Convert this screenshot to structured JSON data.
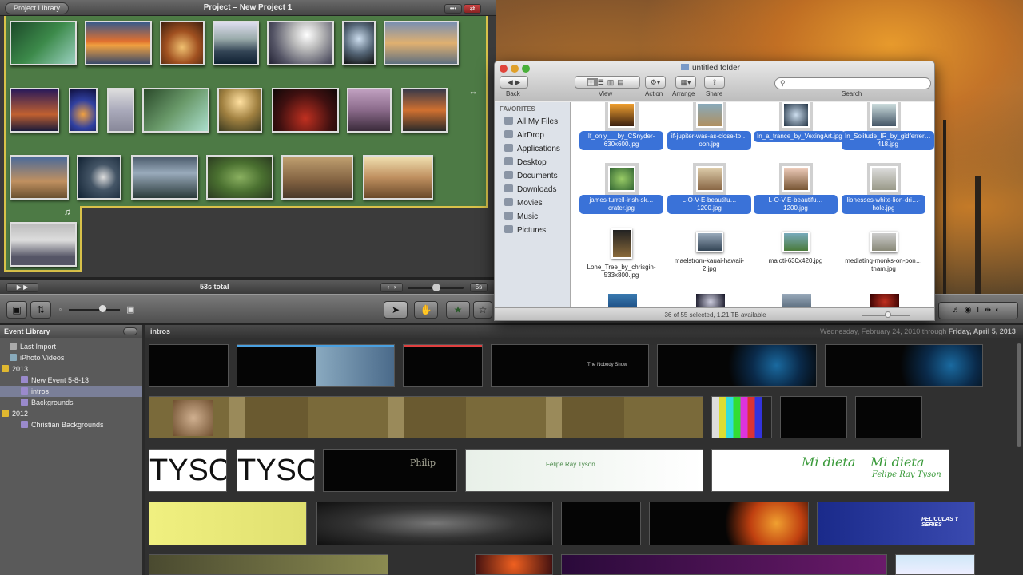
{
  "project": {
    "library_button": "Project Library",
    "title": "Project – New Project 1",
    "total": "53s total"
  },
  "event_library": {
    "header": "Event Library",
    "items": [
      {
        "label": "Last Import",
        "indent": 1,
        "selected": false
      },
      {
        "label": "iPhoto Videos",
        "indent": 1,
        "selected": false
      },
      {
        "label": "2013",
        "indent": 0,
        "selected": false
      },
      {
        "label": "New Event 5-8-13",
        "indent": 2,
        "selected": false
      },
      {
        "label": "intros",
        "indent": 2,
        "selected": true
      },
      {
        "label": "Backgrounds",
        "indent": 2,
        "selected": false
      },
      {
        "label": "2012",
        "indent": 0,
        "selected": false
      },
      {
        "label": "Christian Backgrounds",
        "indent": 2,
        "selected": false
      }
    ]
  },
  "browser": {
    "title": "intros",
    "date_range_prefix": "Wednesday, February 24, 2010",
    "date_range_mid": " through ",
    "date_range_suffix": "Friday, April 5, 2013",
    "clip_texts": {
      "tyson1": "TYSON",
      "tyson2": "TYSON",
      "nobody": "The Nobody Show",
      "mi1": "Mi dieta",
      "mi2": "Mi dieta",
      "felipe": "Felipe Ray Tyson",
      "felipe_green": "Felipe Ray Tyson",
      "philip": "Philip",
      "peliculas": "PELICULAS Y SERIES"
    }
  },
  "finder": {
    "title": "untitled folder",
    "toolbar": {
      "back": "Back",
      "view": "View",
      "action": "Action",
      "arrange": "Arrange",
      "share": "Share",
      "search": "Search"
    },
    "favorites_header": "FAVORITES",
    "favorites": [
      "All My Files",
      "AirDrop",
      "Applications",
      "Desktop",
      "Documents",
      "Downloads",
      "Movies",
      "Music",
      "Pictures"
    ],
    "files": [
      {
        "name": "If_only___by_CSnyder-630x600.jpg",
        "selected": true
      },
      {
        "name": "if-jupiter-was-as-close-to…oon.jpg",
        "selected": true
      },
      {
        "name": "In_a_trance_by_VexingArt.jpg",
        "selected": true
      },
      {
        "name": "In_Solitude_IR_by_gidferrer…418.jpg",
        "selected": true
      },
      {
        "name": "james-turrell-irish-sk…crater.jpg",
        "selected": true
      },
      {
        "name": "L-O-V-E-beautifu…1200.jpg",
        "selected": true
      },
      {
        "name": "L-O-V-E-beautifu…1200.jpg",
        "selected": true
      },
      {
        "name": "lionesses-white-lion-dri…-hole.jpg",
        "selected": true
      },
      {
        "name": "Lone_Tree_by_chrisgin-533x800.jpg",
        "selected": false
      },
      {
        "name": "maelstrom-kauai-hawaii-2.jpg",
        "selected": false
      },
      {
        "name": "maloti-630x420.jpg",
        "selected": false
      },
      {
        "name": "mediating-monks-on-pon…tnam.jpg",
        "selected": false
      }
    ],
    "status": "36 of 55 selected, 1.21 TB available"
  },
  "colors": {
    "project_green": "#4d7a45",
    "selection_blue": "#3a72d8",
    "project_border": "#d9c24a"
  }
}
